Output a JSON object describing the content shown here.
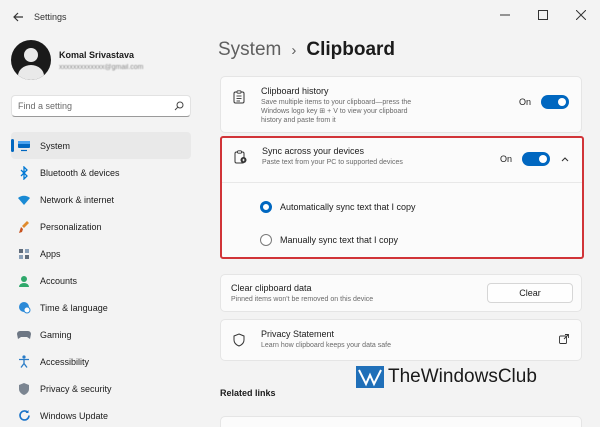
{
  "window": {
    "title": "Settings"
  },
  "profile": {
    "name": "Komal Srivastava",
    "email": "xxxxxxxxxxxxx@gmail.com"
  },
  "search": {
    "placeholder": "Find a setting"
  },
  "nav": [
    {
      "label": "System",
      "icon": "monitor-icon",
      "active": true
    },
    {
      "label": "Bluetooth & devices",
      "icon": "bluetooth-icon"
    },
    {
      "label": "Network & internet",
      "icon": "wifi-icon"
    },
    {
      "label": "Personalization",
      "icon": "brush-icon"
    },
    {
      "label": "Apps",
      "icon": "apps-icon"
    },
    {
      "label": "Accounts",
      "icon": "person-icon"
    },
    {
      "label": "Time & language",
      "icon": "globe-clock-icon"
    },
    {
      "label": "Gaming",
      "icon": "gamepad-icon"
    },
    {
      "label": "Accessibility",
      "icon": "accessibility-icon"
    },
    {
      "label": "Privacy & security",
      "icon": "shield-icon"
    },
    {
      "label": "Windows Update",
      "icon": "update-icon"
    }
  ],
  "breadcrumb": {
    "parent": "System",
    "separator": "›",
    "current": "Clipboard"
  },
  "clipboard_history": {
    "title": "Clipboard history",
    "description_line1": "Save multiple items to your clipboard—press the",
    "description_line2": "Windows logo key ⊞ + V to view your clipboard",
    "description_line3": "history and paste from it",
    "state_label": "On"
  },
  "sync": {
    "title": "Sync across your devices",
    "description": "Paste text from your PC to supported devices",
    "state_label": "On",
    "options": [
      {
        "label": "Automatically sync text that I copy",
        "checked": true
      },
      {
        "label": "Manually sync text that I copy",
        "checked": false
      }
    ]
  },
  "clear": {
    "title": "Clear clipboard data",
    "description": "Pinned items won't be removed on this device",
    "button_label": "Clear"
  },
  "privacy": {
    "title": "Privacy Statement",
    "description": "Learn how clipboard keeps your data safe"
  },
  "related": {
    "title": "Related links"
  },
  "watermark": {
    "text": "TheWindowsClub"
  },
  "colors": {
    "accent": "#0067c0",
    "highlight_border": "#d13438",
    "background": "#f3f3f3"
  }
}
